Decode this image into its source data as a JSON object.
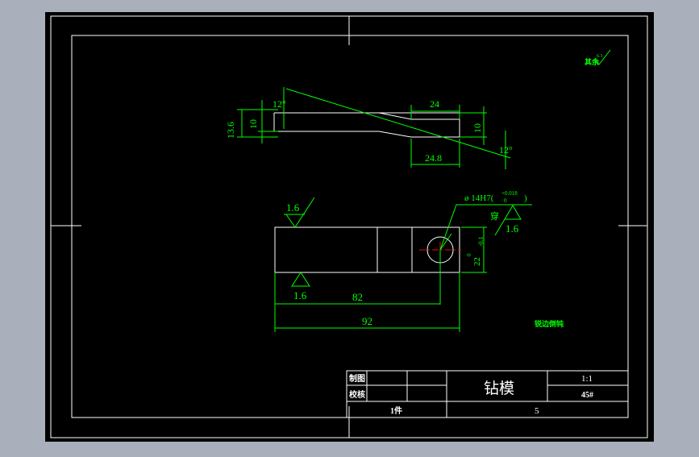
{
  "colors": {
    "window_bg": "#a9b0bc",
    "canvas": "#000000",
    "frame": "#ffffff",
    "dimension": "#00ff00",
    "title_text": "#ffffff",
    "center_mark": "#ff0000"
  },
  "drawing": {
    "surface_note": "其余",
    "surface_note_value": "6.3",
    "top_view": {
      "angle_left": "12°",
      "angle_right": "12°",
      "dim_13_6": "13.6",
      "dim_10_left": "10",
      "dim_10_right": "10",
      "dim_24": "24",
      "dim_24_8": "24.8"
    },
    "front_view": {
      "roughness_top": "1.6",
      "roughness_bottom": "1.6",
      "roughness_right": "1.6",
      "hole_callout": "ø 14H7(",
      "hole_tol_upper": "+0.018",
      "hole_tol_lower": "0",
      "hole_close": ")",
      "hole_note": "穿",
      "dim_82": "82",
      "dim_92": "92",
      "dim_22": "22",
      "dim_22_tol_upper": "0",
      "dim_22_tol_lower": "-0.1"
    },
    "tech_note": "锐边倒钝"
  },
  "title_block": {
    "drawn_label": "制图",
    "checked_label": "校核",
    "part_name": "钻模",
    "scale": "1:1",
    "material": "45#",
    "quantity": "1件",
    "sheet_no": "5"
  }
}
